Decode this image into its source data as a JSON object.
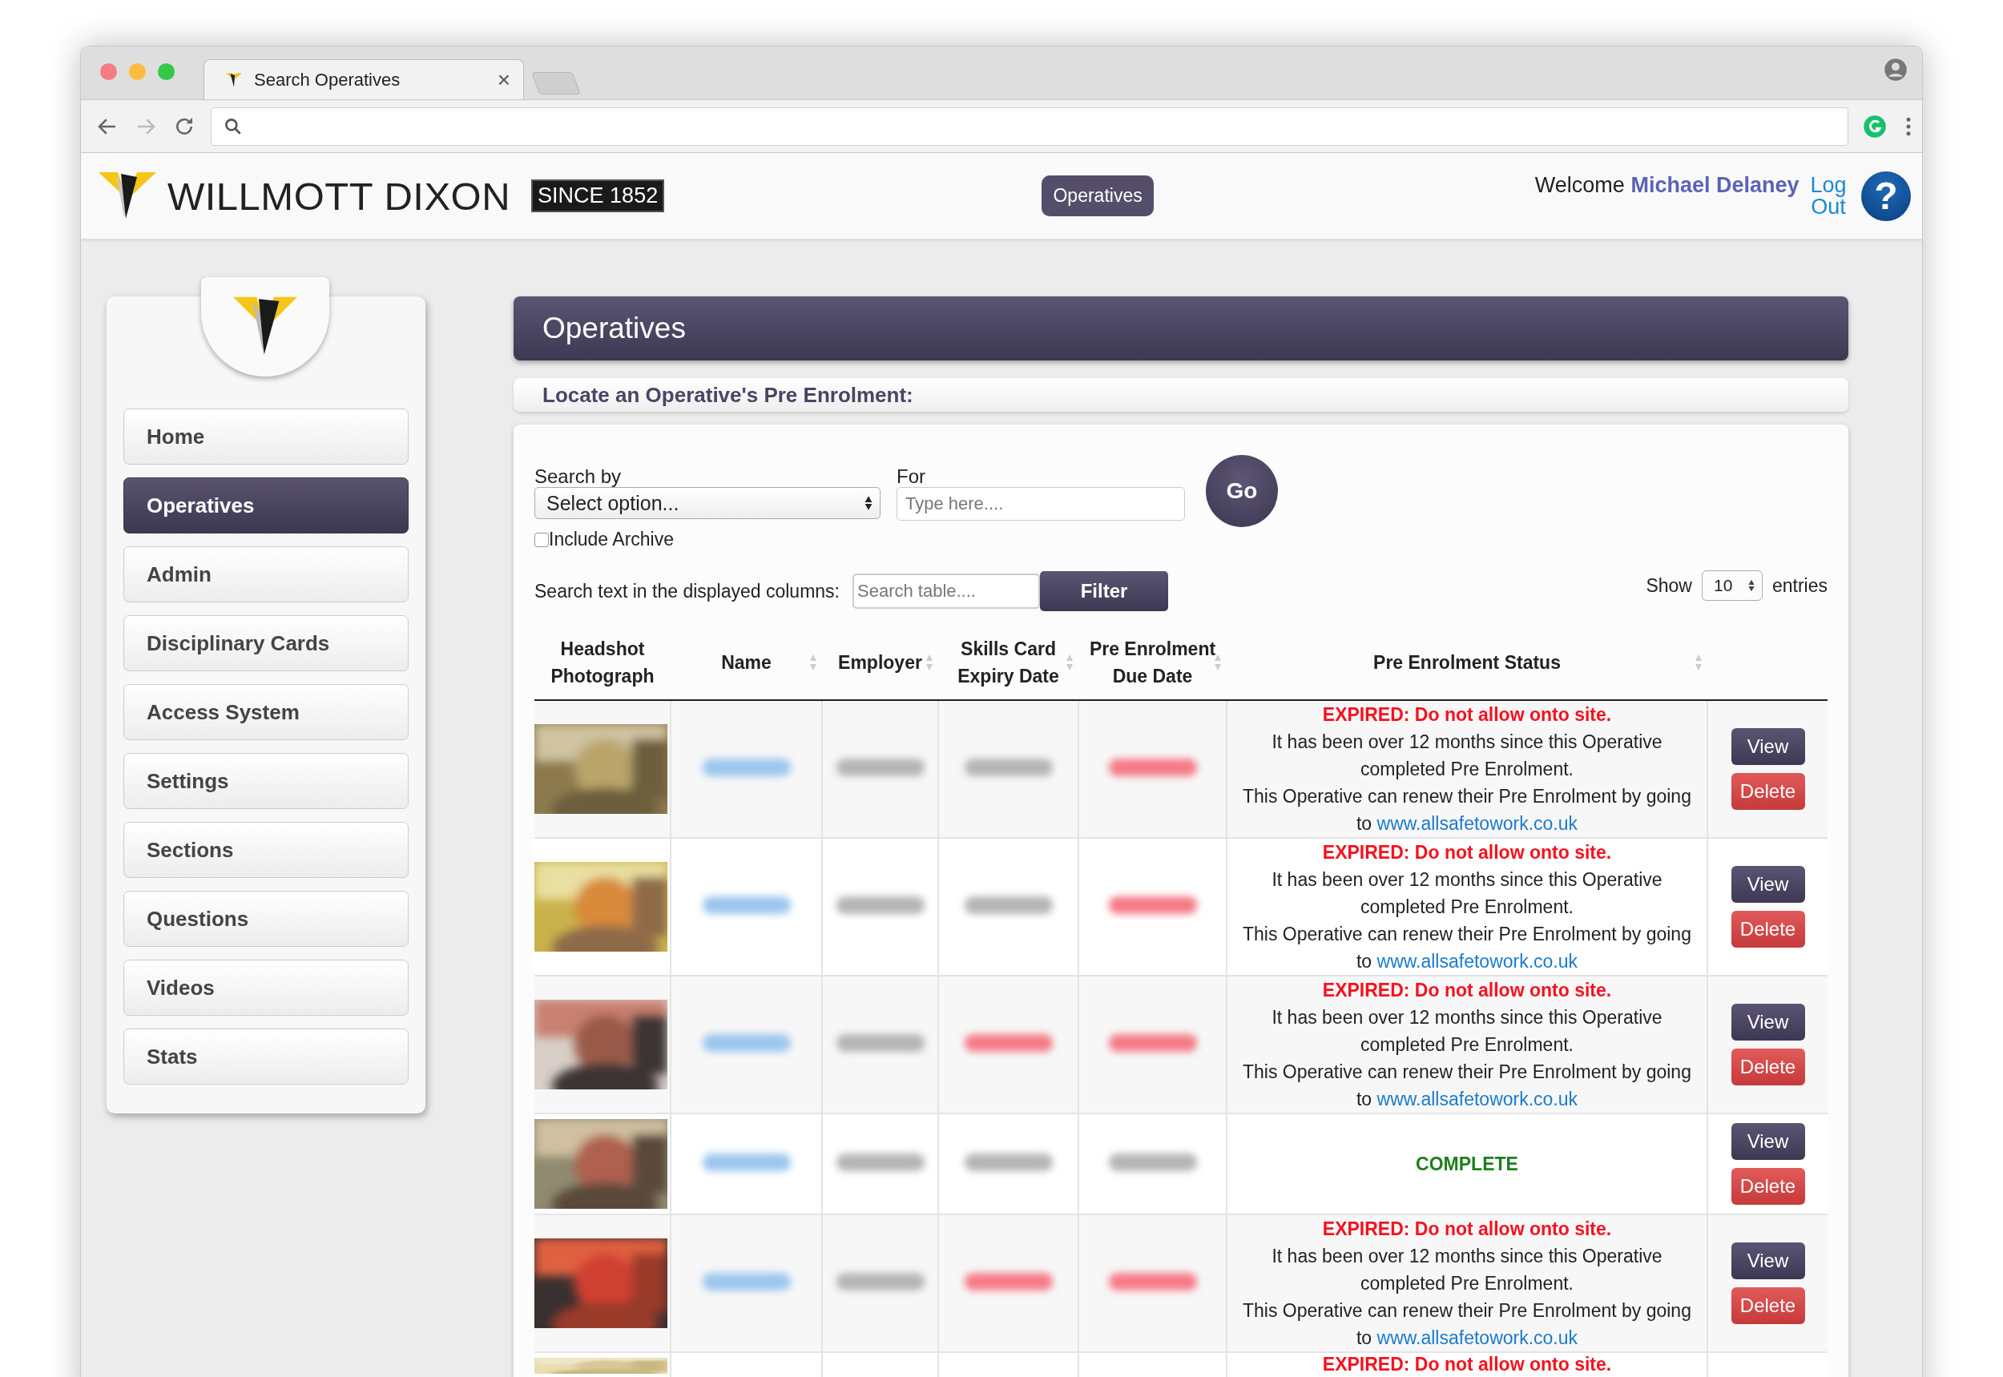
{
  "browser": {
    "tab_title": "Search Operatives",
    "close_glyph": "×"
  },
  "header": {
    "brand": "WILLMOTT DIXON",
    "badge": "SINCE 1852",
    "nav_button": "Operatives",
    "welcome": "Welcome",
    "user": "Michael Delaney",
    "logout": "Log Out",
    "help": "?"
  },
  "sidebar": {
    "items": [
      {
        "label": "Home",
        "selected": false
      },
      {
        "label": "Operatives",
        "selected": true
      },
      {
        "label": "Admin",
        "selected": false
      },
      {
        "label": "Disciplinary Cards",
        "selected": false
      },
      {
        "label": "Access System",
        "selected": false
      },
      {
        "label": "Settings",
        "selected": false
      },
      {
        "label": "Sections",
        "selected": false
      },
      {
        "label": "Questions",
        "selected": false
      },
      {
        "label": "Videos",
        "selected": false
      },
      {
        "label": "Stats",
        "selected": false
      }
    ]
  },
  "page_title": "Operatives",
  "section_title": "Locate an Operative's Pre Enrolment:",
  "search": {
    "search_by_label": "Search by",
    "select_value": "Select option...",
    "for_label": "For",
    "for_placeholder": "Type here....",
    "go": "Go",
    "include_archive": {
      "label": "Include Archive",
      "checked": false
    },
    "filter_label": "Search text in the displayed columns:",
    "filter_placeholder": "Search table....",
    "filter_button": "Filter",
    "show": "Show",
    "entries_value": "10",
    "entries": "entries"
  },
  "table": {
    "columns": [
      {
        "label": "Headshot Photograph",
        "sortable": false
      },
      {
        "label": "Name",
        "sortable": true
      },
      {
        "label": "Employer",
        "sortable": true
      },
      {
        "label": "Skills Card Expiry Date",
        "sortable": true
      },
      {
        "label": "Pre Enrolment Due Date",
        "sortable": true
      },
      {
        "label": "Pre Enrolment Status",
        "sortable": true
      }
    ],
    "rows": [
      {
        "skills_expired": false,
        "due_expired": true,
        "status": {
          "kind": "expired",
          "headline": "EXPIRED: Do not allow onto site.",
          "line_1": "It has been over 12 months since this Operative completed Pre Enrolment.",
          "line_2": "This Operative can renew their Pre Enrolment by going to",
          "link": "www.allsafetowork.co.uk"
        },
        "view": "View",
        "delete": "Delete"
      },
      {
        "skills_expired": false,
        "due_expired": true,
        "status": {
          "kind": "expired",
          "headline": "EXPIRED: Do not allow onto site.",
          "line_1": "It has been over 12 months since this Operative completed Pre Enrolment.",
          "line_2": "This Operative can renew their Pre Enrolment by going to",
          "link": "www.allsafetowork.co.uk"
        },
        "view": "View",
        "delete": "Delete"
      },
      {
        "skills_expired": true,
        "due_expired": true,
        "status": {
          "kind": "expired",
          "headline": "EXPIRED: Do not allow onto site.",
          "line_1": "It has been over 12 months since this Operative completed Pre Enrolment.",
          "line_2": "This Operative can renew their Pre Enrolment by going to",
          "link": "www.allsafetowork.co.uk"
        },
        "view": "View",
        "delete": "Delete"
      },
      {
        "skills_expired": false,
        "due_expired": false,
        "status": {
          "kind": "complete",
          "headline": "COMPLETE"
        },
        "view": "View",
        "delete": "Delete"
      },
      {
        "skills_expired": true,
        "due_expired": true,
        "status": {
          "kind": "expired",
          "headline": "EXPIRED: Do not allow onto site.",
          "line_1": "It has been over 12 months since this Operative completed Pre Enrolment.",
          "line_2": "This Operative can renew their Pre Enrolment by going to",
          "link": "www.allsafetowork.co.uk"
        },
        "view": "View",
        "delete": "Delete"
      },
      {
        "status": {
          "kind": "expired",
          "headline": "EXPIRED: Do not allow onto site."
        }
      }
    ]
  }
}
